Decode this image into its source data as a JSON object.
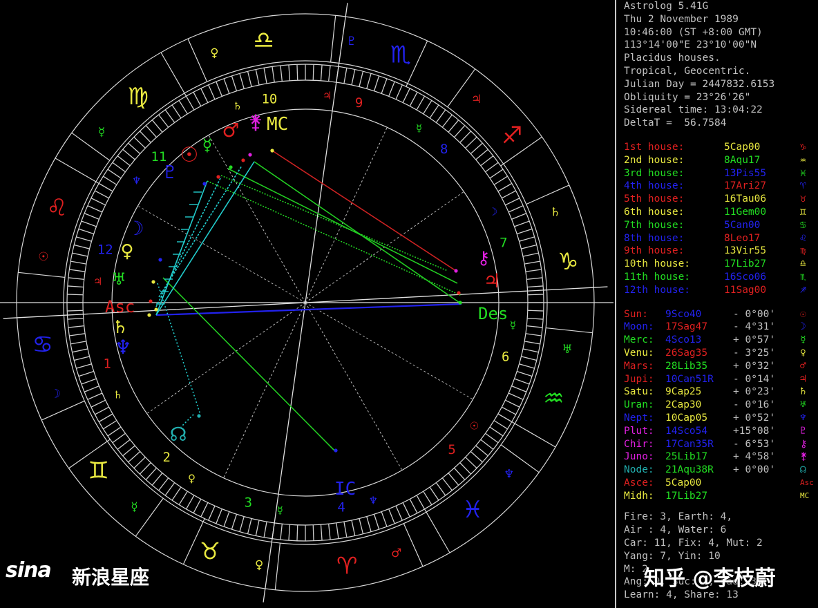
{
  "header_lines": [
    "Astrolog 5.41G",
    "Thu 2 November 1989",
    "10:46:00 (ST +8:00 GMT)",
    "113°14'00\"E 23°10'00\"N",
    "Placidus houses.",
    "Tropical, Geocentric.",
    "Julian Day = 2447832.6153",
    "Obliquity = 23°26'26\"",
    "Sidereal time: 13:04:22",
    "DeltaT =  56.7584"
  ],
  "houses": [
    {
      "label": "1st house:",
      "value": "5Cap00",
      "sign": "♑",
      "label_color": "#e02020",
      "value_color": "#e8e840",
      "sign_color": "#e02020"
    },
    {
      "label": "2nd house:",
      "value": "8Aqu17",
      "sign": "♒",
      "label_color": "#e8e840",
      "value_color": "#22dd22",
      "sign_color": "#e8e840"
    },
    {
      "label": "3rd house:",
      "value": "13Pis55",
      "sign": "♓",
      "label_color": "#22dd22",
      "value_color": "#2222ee",
      "sign_color": "#22dd22"
    },
    {
      "label": "4th house:",
      "value": "17Ari27",
      "sign": "♈",
      "label_color": "#2222ee",
      "value_color": "#e02020",
      "sign_color": "#2222ee"
    },
    {
      "label": "5th house:",
      "value": "16Tau06",
      "sign": "♉",
      "label_color": "#e02020",
      "value_color": "#e8e840",
      "sign_color": "#e02020"
    },
    {
      "label": "6th house:",
      "value": "11Gem00",
      "sign": "♊",
      "label_color": "#e8e840",
      "value_color": "#22dd22",
      "sign_color": "#e8e840"
    },
    {
      "label": "7th house:",
      "value": "5Can00",
      "sign": "♋",
      "label_color": "#22dd22",
      "value_color": "#2222ee",
      "sign_color": "#22dd22"
    },
    {
      "label": "8th house:",
      "value": "8Leo17",
      "sign": "♌",
      "label_color": "#2222ee",
      "value_color": "#e02020",
      "sign_color": "#2222ee"
    },
    {
      "label": "9th house:",
      "value": "13Vir55",
      "sign": "♍",
      "label_color": "#e02020",
      "value_color": "#e8e840",
      "sign_color": "#e02020"
    },
    {
      "label": "10th house:",
      "value": "17Lib27",
      "sign": "♎",
      "label_color": "#e8e840",
      "value_color": "#22dd22",
      "sign_color": "#e8e840"
    },
    {
      "label": "11th house:",
      "value": "16Sco06",
      "sign": "♏",
      "label_color": "#22dd22",
      "value_color": "#2222ee",
      "sign_color": "#22dd22"
    },
    {
      "label": "12th house:",
      "value": "11Sag00",
      "sign": "♐",
      "label_color": "#2222ee",
      "value_color": "#e02020",
      "sign_color": "#2222ee"
    }
  ],
  "planets": [
    {
      "name": "Sun:",
      "pos": "9Sco40",
      "speed": "- 0°00'",
      "glyph": "☉",
      "name_color": "#e02020",
      "pos_color": "#2222ee",
      "glyph_color": "#e02020"
    },
    {
      "name": "Moon:",
      "pos": "17Sag47",
      "speed": "- 4°31'",
      "glyph": "☽",
      "name_color": "#2222ee",
      "pos_color": "#e02020",
      "glyph_color": "#2222ee"
    },
    {
      "name": "Merc:",
      "pos": "4Sco13",
      "speed": "+ 0°57'",
      "glyph": "☿",
      "name_color": "#22dd22",
      "pos_color": "#2222ee",
      "glyph_color": "#22dd22"
    },
    {
      "name": "Venu:",
      "pos": "26Sag35",
      "speed": "- 3°25'",
      "glyph": "♀",
      "name_color": "#e8e840",
      "pos_color": "#e02020",
      "glyph_color": "#e8e840"
    },
    {
      "name": "Mars:",
      "pos": "28Lib35",
      "speed": "+ 0°32'",
      "glyph": "♂",
      "name_color": "#e02020",
      "pos_color": "#22dd22",
      "glyph_color": "#e02020"
    },
    {
      "name": "Jupi:",
      "pos": "10Can51R",
      "speed": "- 0°14'",
      "glyph": "♃",
      "name_color": "#e02020",
      "pos_color": "#2222ee",
      "glyph_color": "#e02020"
    },
    {
      "name": "Satu:",
      "pos": "9Cap25",
      "speed": "+ 0°23'",
      "glyph": "♄",
      "name_color": "#e8e840",
      "pos_color": "#e8e840",
      "glyph_color": "#e8e840"
    },
    {
      "name": "Uran:",
      "pos": "2Cap30",
      "speed": "- 0°16'",
      "glyph": "♅",
      "name_color": "#22dd22",
      "pos_color": "#e8e840",
      "glyph_color": "#22dd22"
    },
    {
      "name": "Nept:",
      "pos": "10Cap05",
      "speed": "+ 0°52'",
      "glyph": "♆",
      "name_color": "#2222ee",
      "pos_color": "#e8e840",
      "glyph_color": "#2222ee"
    },
    {
      "name": "Plut:",
      "pos": "14Sco54",
      "speed": "+15°08'",
      "glyph": "♇",
      "name_color": "#e020e0",
      "pos_color": "#2222ee",
      "glyph_color": "#e020e0"
    },
    {
      "name": "Chir:",
      "pos": "17Can35R",
      "speed": "- 6°53'",
      "glyph": "⚷",
      "name_color": "#e020e0",
      "pos_color": "#2222ee",
      "glyph_color": "#e020e0"
    },
    {
      "name": "Juno:",
      "pos": "25Lib17",
      "speed": "+ 4°58'",
      "glyph": "⚵",
      "name_color": "#e020e0",
      "pos_color": "#22dd22",
      "glyph_color": "#e020e0"
    },
    {
      "name": "Node:",
      "pos": "21Aqu38R",
      "speed": "+ 0°00'",
      "glyph": "☊",
      "name_color": "#22b0b0",
      "pos_color": "#22dd22",
      "glyph_color": "#22b0b0"
    },
    {
      "name": "Asce:",
      "pos": "5Cap00",
      "speed": "",
      "glyph": "Asc",
      "name_color": "#e02020",
      "pos_color": "#e8e840",
      "glyph_color": "#e02020"
    },
    {
      "name": "Midh:",
      "pos": "17Lib27",
      "speed": "",
      "glyph": "MC",
      "name_color": "#e8e840",
      "pos_color": "#22dd22",
      "glyph_color": "#e8e840"
    }
  ],
  "summary_lines": [
    "Fire: 3, Earth: 4,",
    "Air : 4, Water: 6",
    "Car: 11, Fix: 4, Mut: 2",
    "Yang: 7, Yin: 10",
    "M: 2",
    "Ang: 9, Suc: 1, Cad: 3",
    "Learn: 4, Share: 13"
  ],
  "wheel": {
    "zodiac_signs": [
      {
        "glyph": "♎",
        "color": "#e8e840"
      },
      {
        "glyph": "♍",
        "color": "#e8e840"
      },
      {
        "glyph": "♌",
        "color": "#e02020"
      },
      {
        "glyph": "♋",
        "color": "#2222ee"
      },
      {
        "glyph": "♊",
        "color": "#e8e840"
      },
      {
        "glyph": "♉",
        "color": "#e8e840"
      },
      {
        "glyph": "♈",
        "color": "#e02020"
      },
      {
        "glyph": "♓",
        "color": "#2222ee"
      },
      {
        "glyph": "♒",
        "color": "#22dd22"
      },
      {
        "glyph": "♑",
        "color": "#e8e840"
      },
      {
        "glyph": "♐",
        "color": "#e02020"
      },
      {
        "glyph": "♏",
        "color": "#2222ee"
      }
    ],
    "rulers": [
      {
        "glyph": "♀",
        "color": "#e8e840"
      },
      {
        "glyph": "☿",
        "color": "#22dd22"
      },
      {
        "glyph": "☉",
        "color": "#e02020"
      },
      {
        "glyph": "☽",
        "color": "#2222ee"
      },
      {
        "glyph": "☿",
        "color": "#22dd22"
      },
      {
        "glyph": "♀",
        "color": "#e8e840"
      },
      {
        "glyph": "♂",
        "color": "#e02020"
      },
      {
        "glyph": "♆",
        "color": "#2222ee"
      },
      {
        "glyph": "♅",
        "color": "#22dd22"
      },
      {
        "glyph": "♄",
        "color": "#e8e840"
      },
      {
        "glyph": "♃",
        "color": "#e02020"
      },
      {
        "glyph": "♇",
        "color": "#2222ee"
      }
    ],
    "house_numbers": [
      {
        "text": "1",
        "color": "#e02020"
      },
      {
        "text": "2",
        "color": "#e8e840"
      },
      {
        "text": "3",
        "color": "#22dd22"
      },
      {
        "text": "4",
        "color": "#2222ee"
      },
      {
        "text": "5",
        "color": "#e02020"
      },
      {
        "text": "6",
        "color": "#e8e840"
      },
      {
        "text": "7",
        "color": "#22dd22"
      },
      {
        "text": "8",
        "color": "#2222ee"
      },
      {
        "text": "9",
        "color": "#e02020"
      },
      {
        "text": "10",
        "color": "#e8e840"
      },
      {
        "text": "11",
        "color": "#22dd22"
      },
      {
        "text": "12",
        "color": "#2222ee"
      }
    ],
    "house_rulers": [
      {
        "glyph": "♄",
        "color": "#e8e840"
      },
      {
        "glyph": "♀",
        "color": "#e8e840"
      },
      {
        "glyph": "☿",
        "color": "#22dd22"
      },
      {
        "glyph": "♆",
        "color": "#2222ee"
      },
      {
        "glyph": "☉",
        "color": "#e02020"
      },
      {
        "glyph": "☿",
        "color": "#22dd22"
      },
      {
        "glyph": "☽",
        "color": "#2222ee"
      },
      {
        "glyph": "☿",
        "color": "#22dd22"
      },
      {
        "glyph": "♃",
        "color": "#e02020"
      },
      {
        "glyph": "♄",
        "color": "#e8e840"
      },
      {
        "glyph": "♆",
        "color": "#2222ee"
      },
      {
        "glyph": "♃",
        "color": "#e02020"
      }
    ],
    "axis_labels": {
      "asc": "Asc",
      "des": "Des",
      "mc": "MC",
      "ic": "IC"
    },
    "chart_planets": [
      {
        "glyph": "☉",
        "color": "#e02020"
      },
      {
        "glyph": "☿",
        "color": "#22dd22"
      },
      {
        "glyph": "♂",
        "color": "#e02020"
      },
      {
        "glyph": "⚵",
        "color": "#e020e0"
      },
      {
        "glyph": "♇",
        "color": "#2222ee"
      },
      {
        "glyph": "☽",
        "color": "#2222ee"
      },
      {
        "glyph": "♀",
        "color": "#e8e840"
      },
      {
        "glyph": "♅",
        "color": "#22dd22"
      },
      {
        "glyph": "♄",
        "color": "#e8e840"
      },
      {
        "glyph": "♆",
        "color": "#2222ee"
      },
      {
        "glyph": "⚷",
        "color": "#e020e0"
      },
      {
        "glyph": "♃",
        "color": "#e02020"
      },
      {
        "glyph": "☊",
        "color": "#22b0b0"
      }
    ]
  },
  "watermarks": {
    "sina": "sina",
    "sina_cn": "新浪星座",
    "zhihu": "知乎 @李枝蔚"
  }
}
